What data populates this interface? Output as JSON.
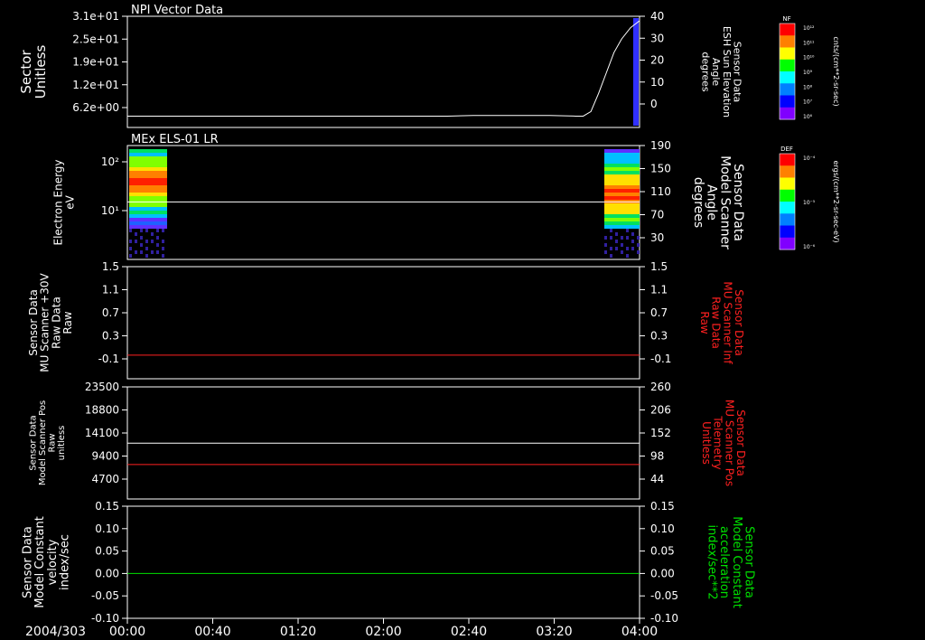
{
  "colors": {
    "white": "#ffffff",
    "red": "#ff2020",
    "green": "#00e000",
    "blue": "#3030ff"
  },
  "time_axis": {
    "date": "2004/303",
    "ticks": [
      "00:00",
      "00:40",
      "01:20",
      "02:00",
      "02:40",
      "03:20",
      "04:00"
    ]
  },
  "colorbars": [
    {
      "label": "NF",
      "units": "cnts/(cm**2-sr-sec)",
      "ticks": [
        "10¹²",
        "10¹¹",
        "10¹⁰",
        "10⁹",
        "10⁸",
        "10⁷",
        "10⁶"
      ]
    },
    {
      "label": "DEF",
      "units": "ergs/(cm**2-sr-sec-eV)",
      "ticks": [
        "10⁻⁴",
        "10⁻⁵",
        "10⁻⁶"
      ]
    }
  ],
  "chart_data": [
    {
      "type": "line",
      "title": "NPI Vector Data",
      "ylabel": [
        "Sector",
        "Unitless"
      ],
      "yticks": [
        "3.1e+01",
        "2.5e+01",
        "1.9e+01",
        "1.2e+01",
        "6.2e+00"
      ],
      "y2label": [
        "Sensor Data",
        "ESH Sun Elevation",
        "Angle",
        "degrees"
      ],
      "y2ticks": [
        "40",
        "30",
        "20",
        "10",
        "0"
      ],
      "y2lim": [
        -9,
        40
      ],
      "series": [
        {
          "color": "white",
          "axis": "right",
          "x": [
            0.0,
            2.5,
            2.7,
            3.3,
            3.5,
            3.56,
            3.62,
            3.68,
            3.74,
            3.8,
            3.86,
            3.93,
            4.0
          ],
          "y": [
            -4,
            -4,
            -3.7,
            -3.7,
            -4,
            -4,
            -2,
            6,
            15,
            24,
            30,
            35,
            38
          ]
        }
      ]
    },
    {
      "type": "heatmap",
      "title": "MEx ELS-01 LR",
      "ylabel": [
        "Electron Energy",
        "eV"
      ],
      "yticks": [
        "10²",
        "10¹"
      ],
      "y2label": [
        "Sensor Data",
        "Model Scanner",
        "Angle",
        "degrees"
      ],
      "y2ticks": [
        "190",
        "150",
        "110",
        "70",
        "30"
      ],
      "y2lim": [
        0,
        190
      ],
      "series": [
        {
          "color": "white",
          "axis": "right",
          "x": [
            0,
            4.0
          ],
          "y": [
            96,
            96
          ]
        }
      ]
    },
    {
      "type": "line",
      "title": "",
      "ylabel": [
        "Sensor Data",
        "MU Scanner +30V",
        "Raw Data",
        "Raw"
      ],
      "yticks": [
        "1.5",
        "1.1",
        "0.7",
        "0.3",
        "-0.1"
      ],
      "y2label": [
        "Sensor Data",
        "MU Scanner Inf",
        "Raw Data",
        "Raw"
      ],
      "y2ticks": [
        "1.5",
        "1.1",
        "0.7",
        "0.3",
        "-0.1"
      ],
      "ylim": [
        -0.4,
        1.5
      ],
      "y2lim": [
        -0.4,
        1.5
      ],
      "series": [
        {
          "color": "red",
          "axis": "left",
          "x": [
            0,
            4.0
          ],
          "y": [
            0.0,
            0.0
          ]
        }
      ]
    },
    {
      "type": "line",
      "title": "",
      "ylabel": [
        "Sensor Data",
        "Model Scanner Pos",
        "Raw",
        "unitless"
      ],
      "yticks": [
        "23500",
        "18800",
        "14100",
        "9400",
        "4700"
      ],
      "y2label": [
        "Sensor Data",
        "MU Scanner Pos",
        "Telemetry",
        "Unitless"
      ],
      "y2ticks": [
        "260",
        "206",
        "152",
        "98",
        "44"
      ],
      "ylim": [
        0,
        23500
      ],
      "y2lim": [
        0,
        260
      ],
      "series": [
        {
          "color": "white",
          "axis": "left",
          "x": [
            0,
            4.0
          ],
          "y": [
            11700,
            11700
          ]
        },
        {
          "color": "red",
          "axis": "right",
          "x": [
            0,
            4.0
          ],
          "y": [
            80,
            80
          ]
        }
      ]
    },
    {
      "type": "line",
      "title": "",
      "ylabel": [
        "Sensor Data",
        "Model Constant",
        "velocity",
        "index/sec"
      ],
      "yticks": [
        "0.15",
        "0.10",
        "0.05",
        "0.00",
        "-0.05",
        "-0.10"
      ],
      "y2label": [
        "Sensor Data",
        "Model Constant",
        "acceleration",
        "index/sec**2"
      ],
      "y2ticks": [
        "0.15",
        "0.10",
        "0.05",
        "0.00",
        "-0.05",
        "-0.10"
      ],
      "ylim": [
        -0.1,
        0.15
      ],
      "y2lim": [
        -0.1,
        0.15
      ],
      "series": [
        {
          "color": "green",
          "axis": "left",
          "x": [
            0,
            4.0
          ],
          "y": [
            0.0,
            0.0
          ]
        }
      ]
    }
  ]
}
